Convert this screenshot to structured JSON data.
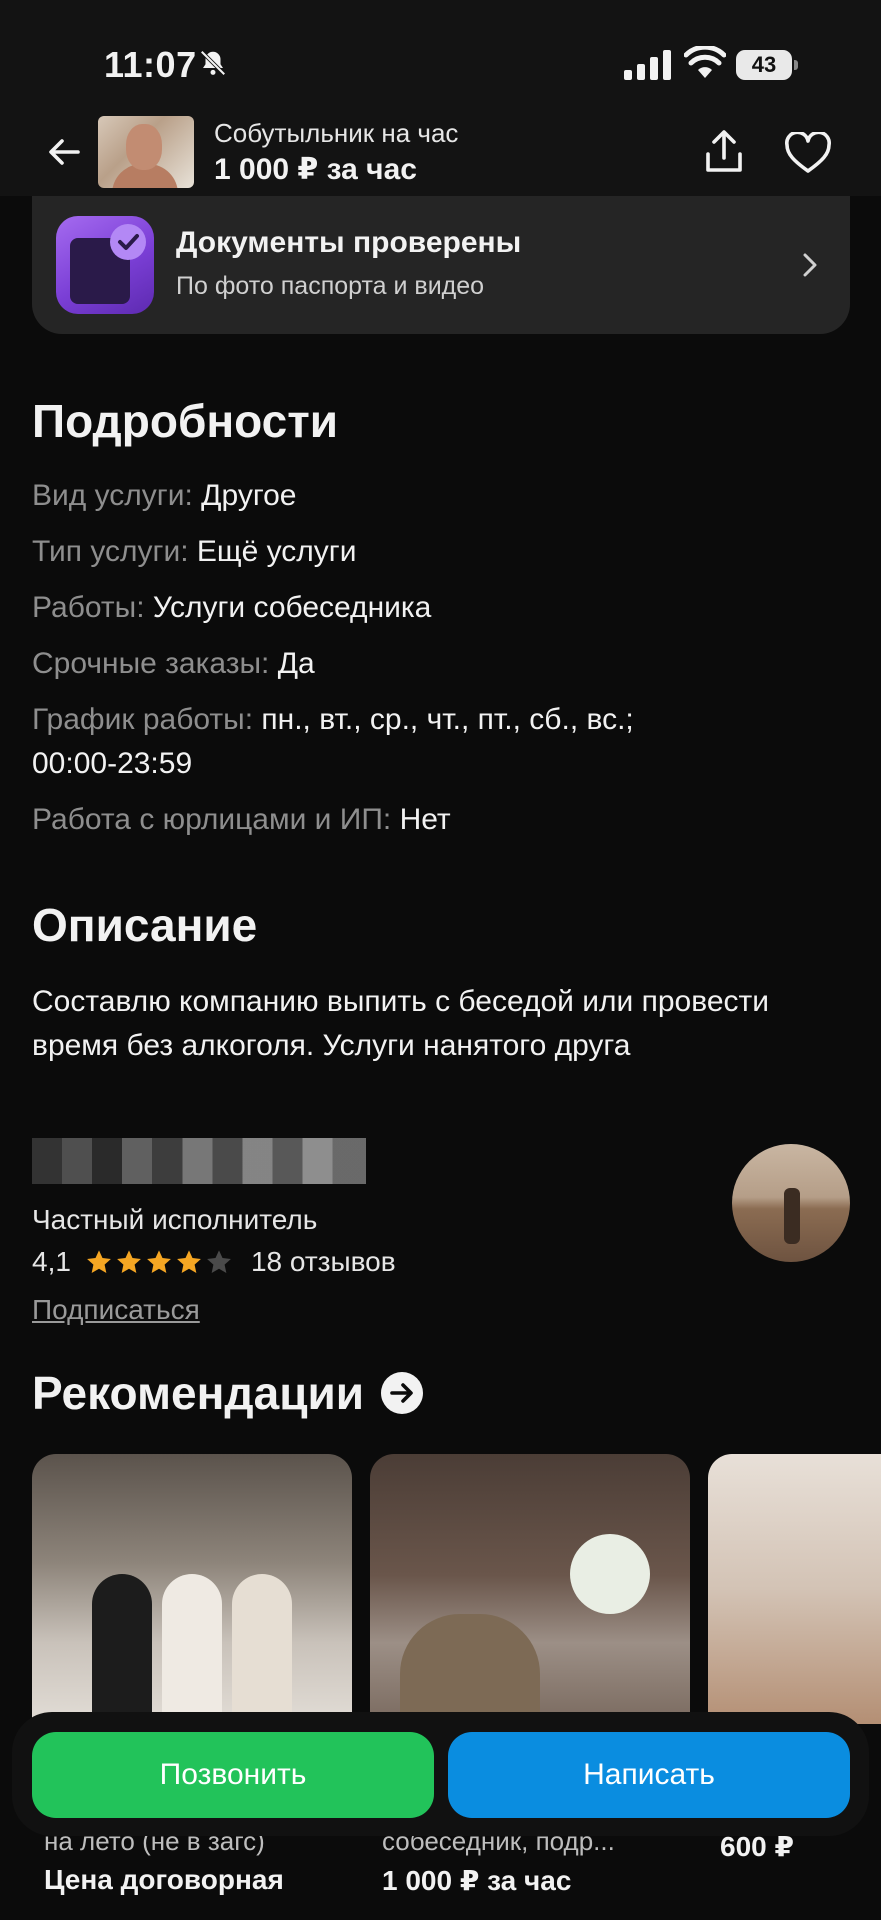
{
  "status_bar": {
    "time": "11:07",
    "battery": "43"
  },
  "header": {
    "title": "Собутыльник на час",
    "price": "1 000 ₽ за час"
  },
  "docs_card": {
    "title": "Документы проверены",
    "subtitle": "По фото паспорта и видео"
  },
  "details": {
    "title": "Подробности",
    "rows": [
      {
        "label": "Вид услуги:",
        "value": "Другое"
      },
      {
        "label": "Тип услуги:",
        "value": "Ещё услуги"
      },
      {
        "label": "Работы:",
        "value": "Услуги собеседника"
      },
      {
        "label": "Срочные заказы:",
        "value": "Да"
      },
      {
        "label": "График работы:",
        "value": "пн., вт., ср., чт., пт., сб., вс.; 00:00-23:59"
      },
      {
        "label": "Работа с юрлицами и ИП:",
        "value": "Нет"
      }
    ]
  },
  "description": {
    "title": "Описание",
    "text": "Составлю компанию выпить с беседой или провести время без алкоголя. Услуги нанятого друга"
  },
  "seller": {
    "type": "Частный исполнитель",
    "rating": "4,1",
    "rating_stars": 4,
    "reviews": "18 отзывов",
    "subscribe": "Подписаться"
  },
  "recommendations": {
    "title": "Рекомендации",
    "cards": [
      {
        "desc": "на лето (не в загс)",
        "price": "Цена договорная"
      },
      {
        "desc": "собеседник, подр...",
        "price": "1 000 ₽ за час"
      },
      {
        "desc": "",
        "price": "600 ₽"
      }
    ]
  },
  "actions": {
    "call": "Позвонить",
    "message": "Написать"
  },
  "colors": {
    "call": "#22c35a",
    "message": "#0a8de0",
    "star": "#f5a623",
    "docs_icon": "#8a4fe6"
  }
}
